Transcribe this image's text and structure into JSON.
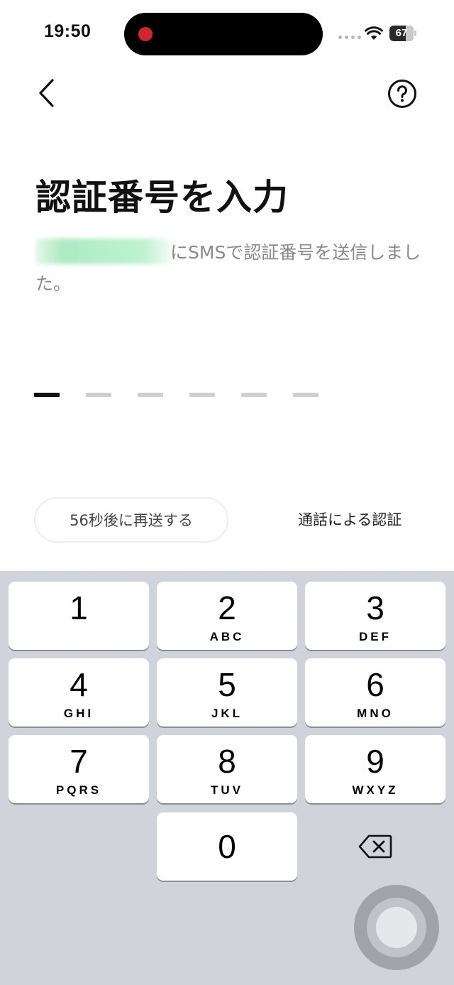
{
  "status_bar": {
    "time": "19:50",
    "battery_level": "67"
  },
  "nav": {
    "back_icon": "chevron-left-icon",
    "help_icon": "question-circle-icon"
  },
  "title": "認証番号を入力",
  "description": {
    "phone_number": "redacted",
    "text": "にSMSで認証番号を送信しました。"
  },
  "code": {
    "length": 6,
    "entered": 0
  },
  "resend_label": "56秒後に再送する",
  "call_auth_label": "通話による認証",
  "keypad": {
    "keys": [
      {
        "digit": "1",
        "letters": ""
      },
      {
        "digit": "2",
        "letters": "ABC"
      },
      {
        "digit": "3",
        "letters": "DEF"
      },
      {
        "digit": "4",
        "letters": "GHI"
      },
      {
        "digit": "5",
        "letters": "JKL"
      },
      {
        "digit": "6",
        "letters": "MNO"
      },
      {
        "digit": "7",
        "letters": "PQRS"
      },
      {
        "digit": "8",
        "letters": "TUV"
      },
      {
        "digit": "9",
        "letters": "WXYZ"
      },
      {
        "digit": "0",
        "letters": ""
      }
    ],
    "delete_icon": "backspace-icon"
  },
  "colors": {
    "text_primary": "#111111",
    "text_secondary": "#8a8a8a",
    "keypad_bg": "#d0d3d9",
    "recording": "#d1262f"
  }
}
